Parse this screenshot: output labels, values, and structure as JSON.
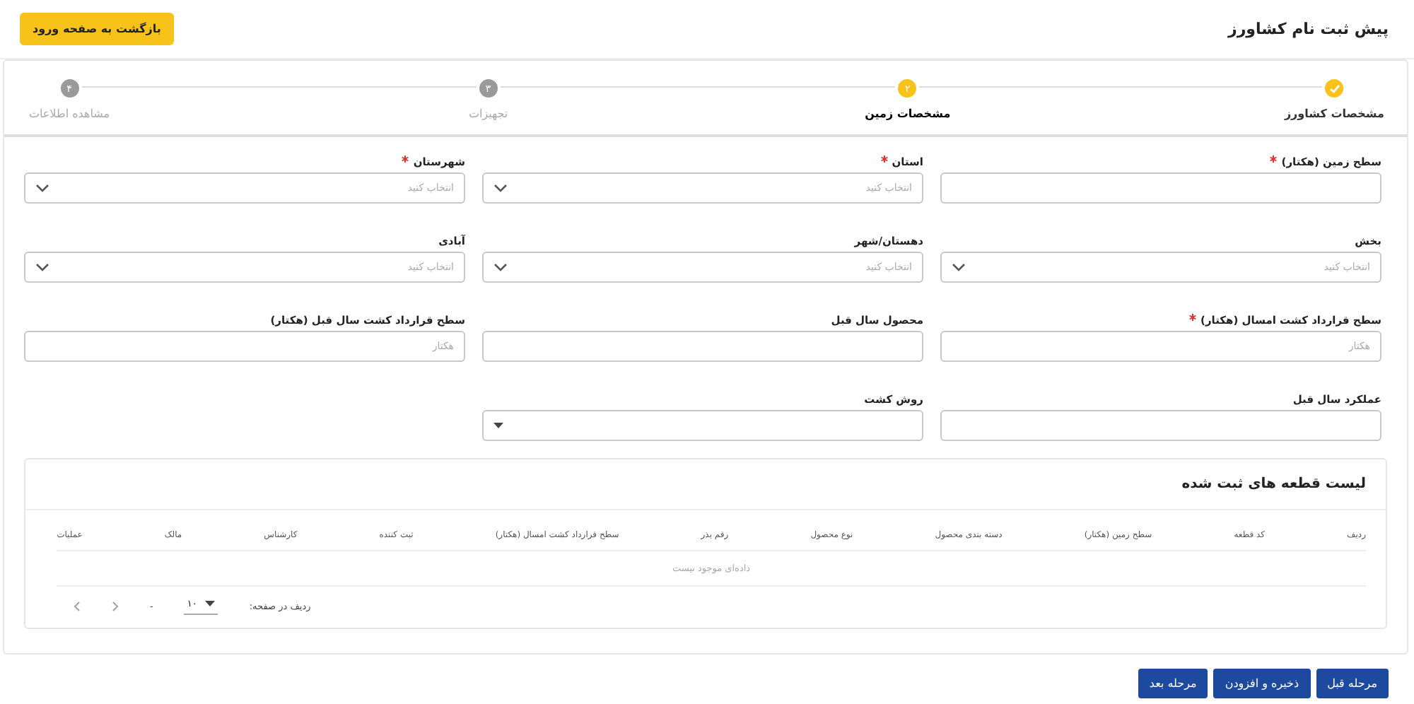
{
  "header": {
    "title": "پیش ثبت نام کشاورز",
    "back_button": "بازگشت به صفحه ورود"
  },
  "steps": [
    {
      "label": "مشخصات کشاورز",
      "done": true,
      "selected": false
    },
    {
      "label": "مشخصات زمین",
      "number": "۲",
      "done": false,
      "selected": true
    },
    {
      "label": "تجهیزات",
      "number": "۳",
      "done": false,
      "selected": false
    },
    {
      "label": "مشاهده اطلاعات",
      "number": "۴",
      "done": false,
      "selected": false
    }
  ],
  "fields": [
    {
      "label": "سطح زمین (هکتار)",
      "required": true,
      "kind": "input"
    },
    {
      "label": "استان",
      "required": true,
      "kind": "select",
      "placeholder": "انتخاب کنید"
    },
    {
      "label": "شهرستان",
      "required": true,
      "kind": "select",
      "placeholder": "انتخاب کنید"
    },
    {
      "label": "بخش",
      "required": false,
      "kind": "select",
      "placeholder": "انتخاب کنید"
    },
    {
      "label": "دهستان/شهر",
      "required": false,
      "kind": "select",
      "placeholder": "انتخاب کنید"
    },
    {
      "label": "آبادی",
      "required": false,
      "kind": "select",
      "placeholder": "انتخاب کنید"
    },
    {
      "label": "سطح قرارداد کشت امسال (هکتار)",
      "required": true,
      "kind": "input",
      "placeholder": "هکتار"
    },
    {
      "label": "محصول سال قبل",
      "required": false,
      "kind": "input"
    },
    {
      "label": "سطح قرارداد کشت سال قبل (هکتار)",
      "required": false,
      "kind": "input",
      "placeholder": "هکتار"
    },
    {
      "label": "عملکرد سال قبل",
      "required": false,
      "kind": "input"
    },
    {
      "label": "روش کشت",
      "required": false,
      "kind": "dropdown"
    }
  ],
  "table": {
    "title": "لیست قطعه های ثبت شده",
    "columns": [
      "ردیف",
      "کد قطعه",
      "سطح زمین (هکتار)",
      "دسته بندی محصول",
      "نوع محصول",
      "رقم بذر",
      "سطح قرارداد کشت امسال (هکتار)",
      "ثبت کننده",
      "کارشناس",
      "مالک",
      "عملیات"
    ],
    "empty_message": "داده‌ای موجود نیست",
    "pagination": {
      "rows_per_page_label": "ردیف در صفحه:",
      "rows_per_page": "۱۰",
      "range": "-"
    }
  },
  "buttons": [
    "مرحله قبل",
    "ذخیره و افزودن",
    "مرحله بعد"
  ]
}
